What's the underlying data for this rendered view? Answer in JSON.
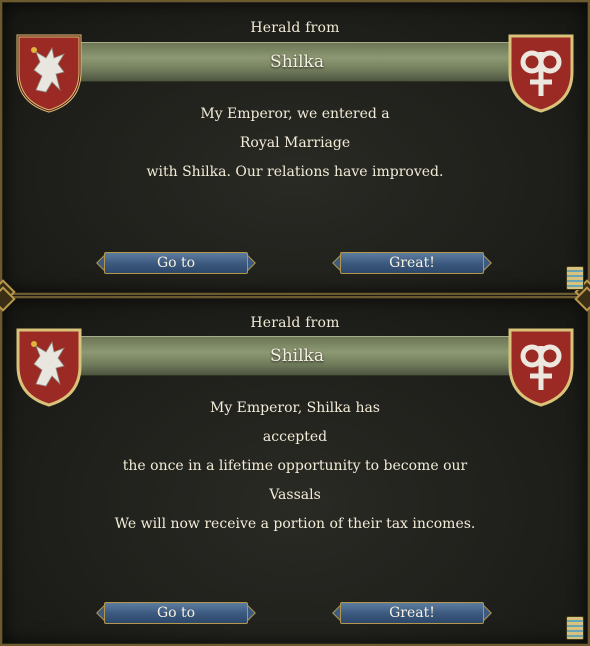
{
  "dialogs": [
    {
      "herald_label": "Herald from",
      "country": "Shilka",
      "message_lines": [
        "My Emperor, we entered a",
        "Royal Marriage",
        "with Shilka. Our relations have improved."
      ],
      "buttons": {
        "goto_label": "Go to",
        "confirm_label": "Great!"
      }
    },
    {
      "herald_label": "Herald from",
      "country": "Shilka",
      "message_lines": [
        "My Emperor, Shilka has",
        "accepted",
        "the once in a lifetime opportunity to become our",
        "Vassals",
        "We will now receive a portion of their tax incomes."
      ],
      "buttons": {
        "goto_label": "Go to",
        "confirm_label": "Great!"
      }
    }
  ],
  "icons": {
    "left_shield": "white-griffin-on-red-shield-icon",
    "right_shield": "white-rune-on-red-shield-icon",
    "ledger": "ledger-icon"
  },
  "colors": {
    "shield_red": "#9c2a24",
    "banner_green": "#7b8662",
    "button_blue": "#3d5b80",
    "gold_trim": "#b3954c"
  }
}
